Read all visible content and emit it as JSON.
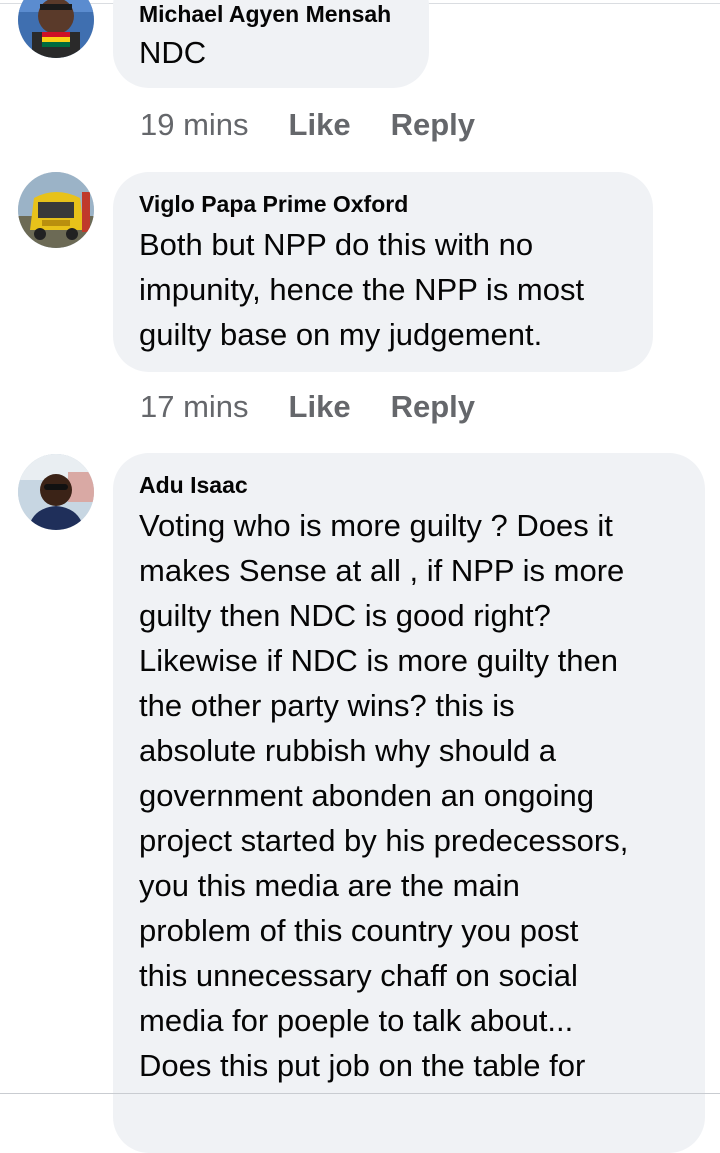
{
  "comments": [
    {
      "author": "Michael Agyen Mensah",
      "text": "NDC",
      "time": "19 mins",
      "like_label": "Like",
      "reply_label": "Reply"
    },
    {
      "author": "Viglo Papa Prime Oxford",
      "text": "Both but NPP do this with no\nimpunity, hence the NPP is most\nguilty base on my judgement.",
      "time": "17 mins",
      "like_label": "Like",
      "reply_label": "Reply"
    },
    {
      "author": "Adu Isaac",
      "text": "Voting who is more guilty ? Does it\nmakes Sense at all , if NPP is more\nguilty then NDC is good right?\nLikewise if NDC is more guilty then\nthe other party wins? this is\nabsolute rubbish why should a\ngovernment abonden an ongoing\nproject started by his predecessors,\nyou this media are the main\nproblem of this country you post\nthis unnecessary chaff on social\nmedia for poeple to talk about...\nDoes this put job on the table for"
    }
  ],
  "colors": {
    "bubble": "#f0f2f5",
    "meta_text": "#65676b",
    "body_text": "#050505"
  }
}
